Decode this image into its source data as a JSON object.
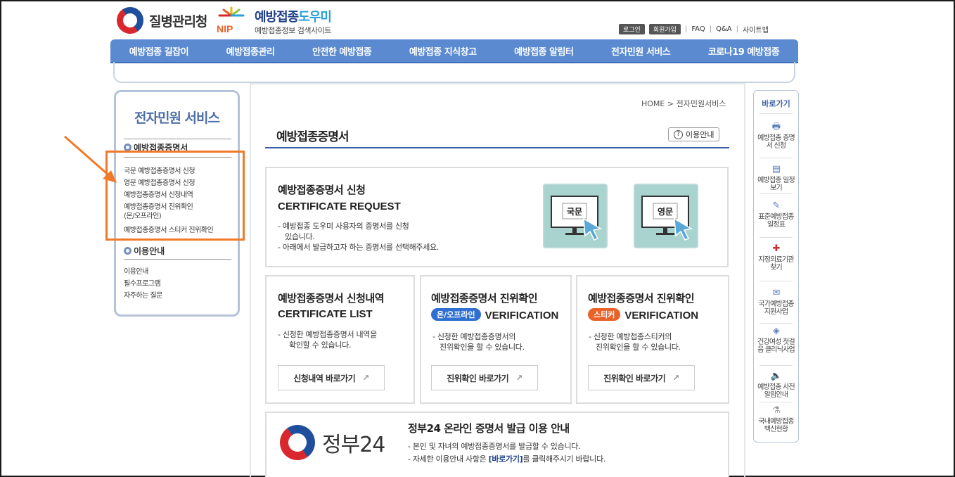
{
  "header": {
    "kdca_name": "질병관리청",
    "nip_title_main": "예방접종",
    "nip_title_accent": "도우미",
    "nip_sub": "예방접종정보 검색사이트",
    "nip_letters": "NIP",
    "links": {
      "login": "로그인",
      "join": "회원가입",
      "faq": "FAQ",
      "qna": "Q&A",
      "sitemap": "사이트맵"
    }
  },
  "nav": [
    "예방접종 길잡이",
    "예방접종관리",
    "안전한 예방접종",
    "예방접종 지식창고",
    "예방접종 알림터",
    "전자민원 서비스",
    "코로나19 예방접종"
  ],
  "sidebar": {
    "title": "전자민원 서비스",
    "section1": "예방접종증명서",
    "items": [
      "국문 예방접종증명서 신청",
      "영문 예방접종증명서 신청",
      "예방접종증명서 신청내역",
      "예방접종증명서 진위확인",
      "(온/오프라인)",
      "예방접종증명서 스티커 진위확인"
    ],
    "section2": "이용안내",
    "items2": [
      "이용안내",
      "필수프로그램",
      "자주하는 질문"
    ]
  },
  "main": {
    "breadcrumb": "HOME > 전자민원서비스",
    "page_title": "예방접종증명서",
    "guide_button": "이용안내",
    "request": {
      "title_ko": "예방접종증명서 신청",
      "title_en": "CERTIFICATE REQUEST",
      "desc1": "- 예방접종 도우미 사용자의 증명서를 신청",
      "desc1b": "있습니다.",
      "desc2": "- 아래에서 발급하고자 하는 증명서를 선택해주세요.",
      "korean_label": "국문",
      "english_label": "영문"
    },
    "list": {
      "title_ko": "예방접종증명서 신청내역",
      "title_en": "CERTIFICATE LIST",
      "desc1": "- 신청한 예방접종증명서 내역을",
      "desc2": "확인할 수 있습니다.",
      "button": "신청내역 바로가기"
    },
    "verify": {
      "title_ko": "예방접종증명서 진위확인",
      "pill": "온/오프라인",
      "title_en": "VERIFICATION",
      "desc1": "- 신청한 예방접종증명서의",
      "desc2": "진위확인을 할 수 있습니다.",
      "button": "진위확인 바로가기"
    },
    "sticker": {
      "title_ko": "예방접종증명서 진위확인",
      "pill": "스티커",
      "title_en": "VERIFICATION",
      "desc1": "- 신청한 예방접종스티커의",
      "desc2": "진위확인을 할 수 있습니다.",
      "button": "진위확인 바로가기"
    },
    "gov24": {
      "logo_text": "정부24",
      "title": "정부24 온라인 증명서 발급 이용 안내",
      "desc1": "- 본인 및 자녀의 예방접종증명서를 발급할 수 있습니다.",
      "desc2_pre": "- 자세한 이용안내 사항은 ",
      "desc2_link": "[바로가기]",
      "desc2_post": "를 클릭해주시기 바랍니다."
    }
  },
  "quick": {
    "head": "바로가기",
    "items": [
      "예방접종 증명서 신청",
      "예방접종 일정보기",
      "표준예방접종 일정표",
      "지정의료기관 찾기",
      "국가예방접종 지원사업",
      "건강여성 첫걸음 클리닉사업",
      "예방접종 사전알림안내",
      "국내예방접종 백신현황"
    ]
  },
  "colors": {
    "nav": "#5b8ad1",
    "highlight": "#f07a2a",
    "pill_blue": "#2f6fd0",
    "pill_orange": "#e8622a",
    "card": "#a8d3cf"
  }
}
